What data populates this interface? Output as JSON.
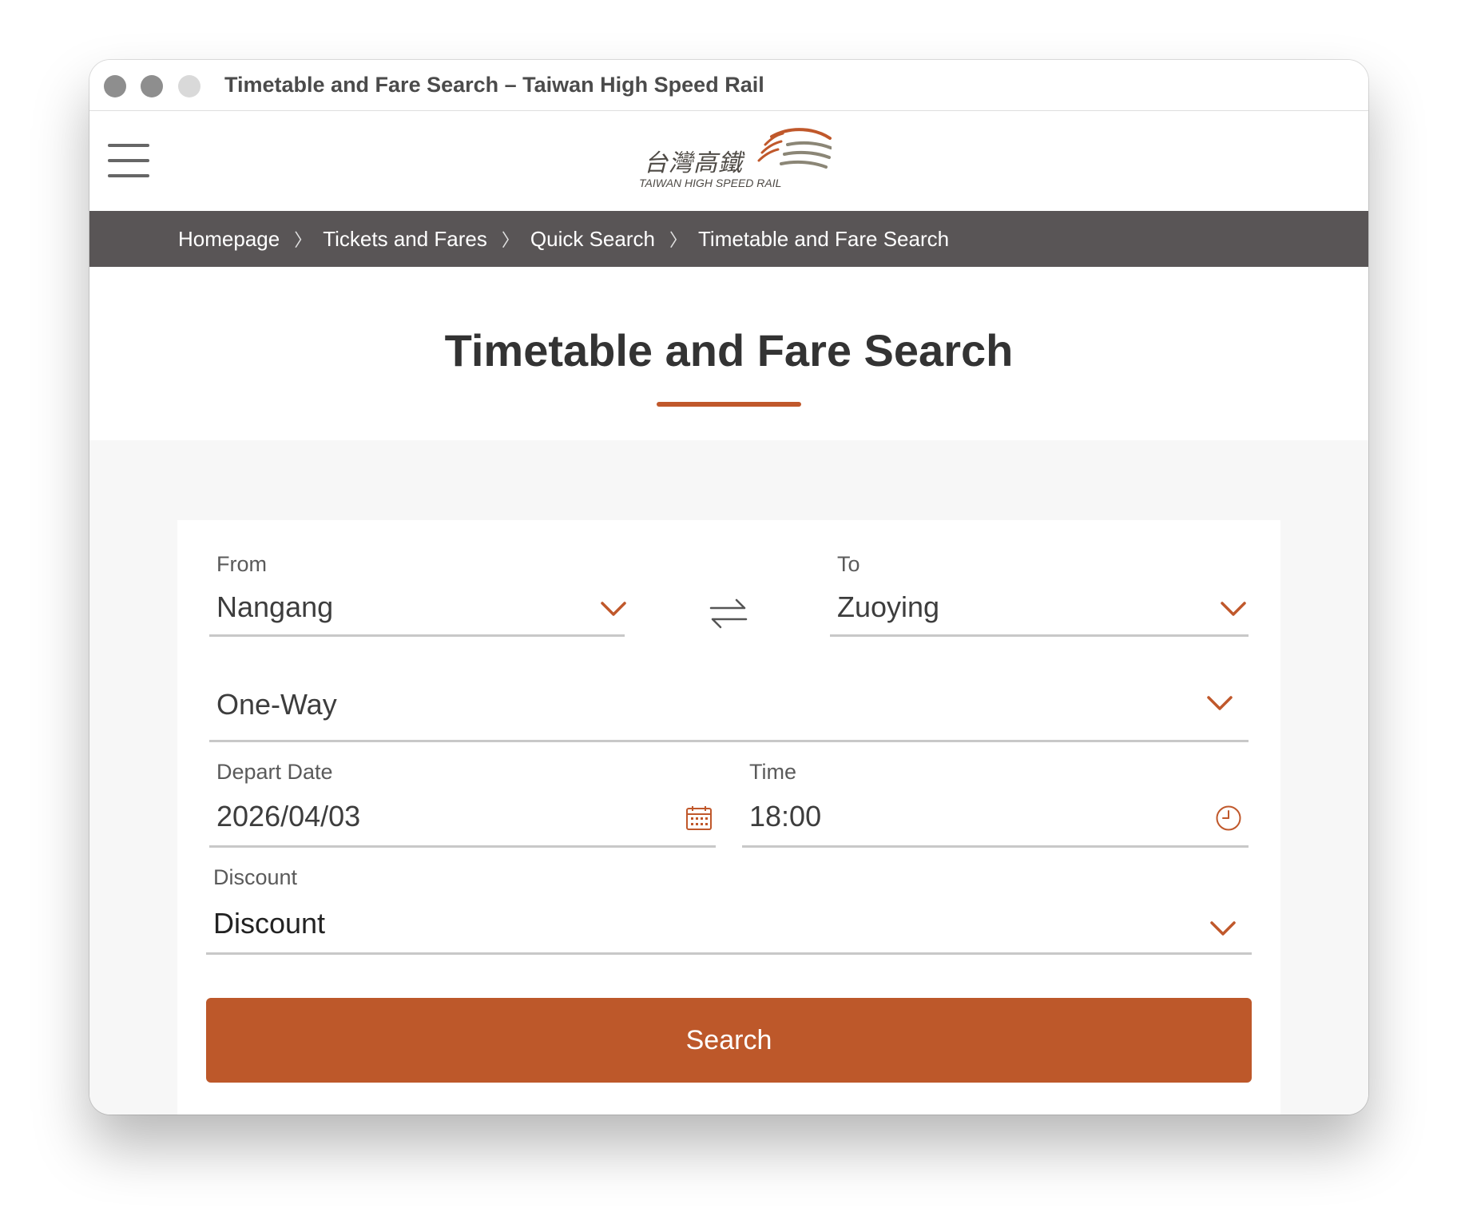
{
  "window": {
    "title": "Timetable and Fare Search – Taiwan High Speed Rail"
  },
  "header": {
    "menu_icon": "hamburger-menu-icon",
    "logo": {
      "name_cjk": "台灣高鐵",
      "name_en": "TAIWAN HIGH SPEED RAIL"
    }
  },
  "breadcrumb": {
    "separator": "〉",
    "items": [
      {
        "label": "Homepage"
      },
      {
        "label": "Tickets and Fares"
      },
      {
        "label": "Quick Search"
      },
      {
        "label": "Timetable and Fare Search"
      }
    ]
  },
  "page": {
    "title": "Timetable and Fare Search"
  },
  "form": {
    "from": {
      "label": "From",
      "value": "Nangang"
    },
    "to": {
      "label": "To",
      "value": "Zuoying"
    },
    "swap_icon": "swap-arrows-icon",
    "trip_type": {
      "value": "One-Way"
    },
    "depart_date": {
      "label": "Depart Date",
      "value": "2026/04/03",
      "icon": "calendar-icon"
    },
    "time": {
      "label": "Time",
      "value": "18:00",
      "icon": "clock-icon"
    },
    "discount": {
      "label": "Discount",
      "value": "Discount"
    },
    "search_label": "Search"
  },
  "colors": {
    "accent": "#bd582a",
    "breadcrumb_bg": "#595556",
    "content_bg": "#f7f7f7",
    "field_border": "#c8c8c8"
  }
}
